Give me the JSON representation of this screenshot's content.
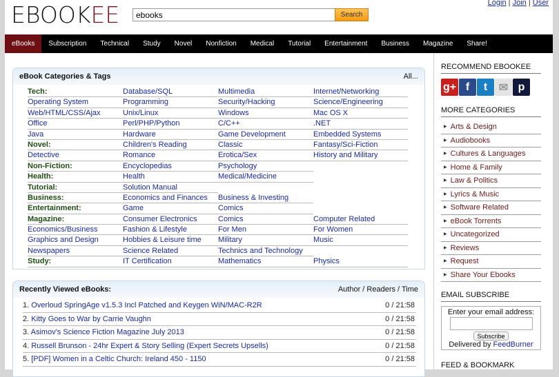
{
  "header": {
    "logo_black": "EBOOK",
    "logo_red": "EE",
    "search_value": "ebooks",
    "search_button": "Search",
    "login": "Login",
    "join": "Join",
    "user": "User",
    "sep": "|"
  },
  "nav": [
    "eBooks",
    "Subscription",
    "Technical",
    "Study",
    "Novel",
    "Nonfiction",
    "Medical",
    "Tutorial",
    "Entertainment",
    "Business",
    "Magazine",
    "Share!"
  ],
  "categories": {
    "title": "eBook Categories & Tags",
    "all": "All...",
    "rows": [
      [
        {
          "t": "Tech:",
          "h": true
        },
        {
          "t": "Database/SQL"
        },
        {
          "t": "Multimedia"
        },
        {
          "t": "Internet/Networking"
        }
      ],
      [
        {
          "t": "Operating System"
        },
        {
          "t": "Programming"
        },
        {
          "t": "Security/Hacking"
        },
        {
          "t": "Science/Engineering"
        }
      ],
      [
        {
          "t": "Web/HTML/CSS/Ajax"
        },
        {
          "t": "Unix/Linux"
        },
        {
          "t": "Windows"
        },
        {
          "t": "Mac OS X"
        }
      ],
      [
        {
          "t": "Office"
        },
        {
          "t": "Perl/PHP/Python"
        },
        {
          "t": "C/C++"
        },
        {
          "t": ".NET"
        }
      ],
      [
        {
          "t": "Java"
        },
        {
          "t": "Hardware"
        },
        {
          "t": "Game Development"
        },
        {
          "t": "Embedded Systems"
        }
      ],
      [
        {
          "t": "Novel:",
          "h": true
        },
        {
          "t": "Children's Reading"
        },
        {
          "t": "Classic"
        },
        {
          "t": "Fantasy/Sci-Fiction"
        }
      ],
      [
        {
          "t": "Detective"
        },
        {
          "t": "Romance"
        },
        {
          "t": "Erotica/Sex"
        },
        {
          "t": "History and Military"
        }
      ],
      [
        {
          "t": "Non-Fiction:",
          "h": true
        },
        {
          "t": "Encyclopedias"
        },
        {
          "t": "Psychology"
        },
        null
      ],
      [
        {
          "t": "Health:",
          "h": true
        },
        {
          "t": "Health"
        },
        {
          "t": "Medical/Medicine"
        },
        null
      ],
      [
        {
          "t": "Tutorial:",
          "h": true
        },
        {
          "t": "Solution Manual"
        },
        null,
        null
      ],
      [
        {
          "t": "Business:",
          "h": true
        },
        {
          "t": "Economics and Finances"
        },
        {
          "t": "Business & Investing"
        },
        null
      ],
      [
        {
          "t": "Entertainment:",
          "h": true
        },
        {
          "t": "Game"
        },
        {
          "t": "Comics"
        },
        null
      ],
      [
        {
          "t": "Magazine:",
          "h": true
        },
        {
          "t": "Consumer Electronics"
        },
        {
          "t": "Comics"
        },
        {
          "t": "Computer Related"
        }
      ],
      [
        {
          "t": "Economics/Business"
        },
        {
          "t": "Fashion & Lifestyle"
        },
        {
          "t": "For Men"
        },
        {
          "t": "For Women"
        }
      ],
      [
        {
          "t": "Graphics and Design"
        },
        {
          "t": "Hobbies & Leisure time"
        },
        {
          "t": "Military"
        },
        {
          "t": "Music"
        }
      ],
      [
        {
          "t": "Newspapers"
        },
        {
          "t": "Science Related"
        },
        {
          "t": "Technics and Technology"
        },
        null
      ],
      [
        {
          "t": "Study:",
          "h": true
        },
        {
          "t": "IT Certification"
        },
        {
          "t": "Mathematics"
        },
        {
          "t": "Physics"
        }
      ]
    ]
  },
  "recent": {
    "title": "Recently Viewed eBooks:",
    "columns": "Author / Readers / Time",
    "items": [
      {
        "n": "1.",
        "t": "Overloud SpringAge v1.5.3 Incl Patched and Keygen WiN/MAC-R2R",
        "v": "0 / 21:58"
      },
      {
        "n": "2.",
        "t": "Kitty Goes to War by Carrie Vaughn",
        "v": "0 / 21:58"
      },
      {
        "n": "3.",
        "t": "Asimov's Science Fiction Magazine July 2013",
        "v": "0 / 21:58"
      },
      {
        "n": "4.",
        "t": "Russell Brunson - 24hr Expert & Story Selling (Expert Secrets Upsells)",
        "v": "0 / 21:58"
      },
      {
        "n": "5.",
        "t": "[PDF] Women in a Celtic Church: Ireland 450 - 1150",
        "v": "0 / 21:58"
      }
    ]
  },
  "sidebar": {
    "recommend": "RECOMMEND EBOOKEE",
    "share": [
      {
        "icon": "google-plus-icon",
        "g": "g+",
        "c": "#c8201c"
      },
      {
        "icon": "facebook-icon",
        "g": "f",
        "c": "#2b4a8c"
      },
      {
        "icon": "twitter-icon",
        "g": "t",
        "c": "#1b7fc4"
      },
      {
        "icon": "email-icon",
        "g": "✉",
        "c": "#e4e4e4"
      },
      {
        "icon": "pinboard-icon",
        "g": "p",
        "c": "#12183a"
      }
    ],
    "more": "MORE CATEGORIES",
    "cats": [
      "Arts & Design",
      "Audiobooks",
      "Cultures & Languages",
      "Home & Family",
      "Law & Politics",
      "Lyrics & Music",
      "Software Related",
      "eBook Torrents",
      "Uncategorized",
      "Reviews",
      "Request",
      "Share Your Ebooks"
    ],
    "email_title": "EMAIL SUBSCRIBE",
    "email_label": "Enter your email address:",
    "subscribe": "Subscribe",
    "delivered": "Delivered by ",
    "feedburner": "FeedBurner",
    "feed": "FEED & BOOKMARK"
  },
  "colors": {
    "nav_active": "#6d0f12",
    "link": "#1a2a9c",
    "label_green": "#1f4d14",
    "side_link": "#6b1a1a",
    "search_btn": "#f29a10"
  }
}
